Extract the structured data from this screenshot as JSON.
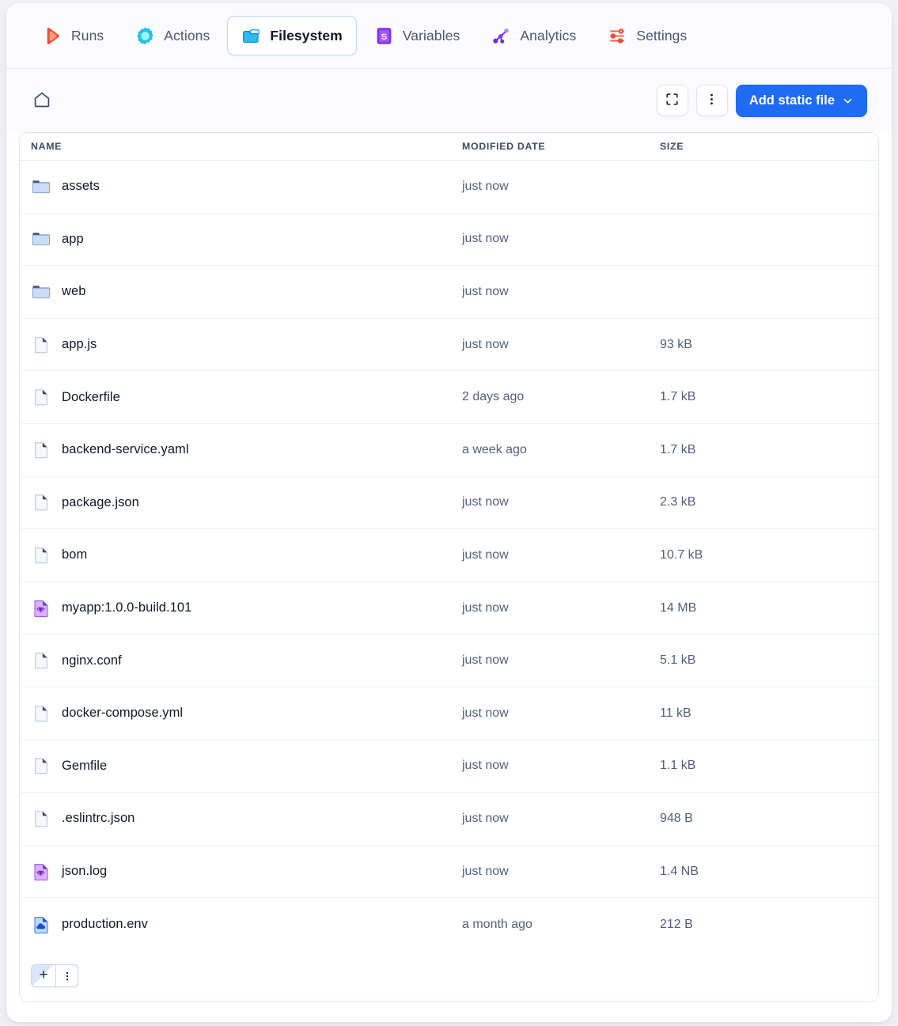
{
  "app": {
    "accent_color": "#1f6bf2",
    "card_background": "#ffffff",
    "page_background": "#f1f2f6"
  },
  "tabs": [
    {
      "label": "Runs",
      "icon": "play-triangle-icon",
      "active": false,
      "color": "#e8533a"
    },
    {
      "label": "Actions",
      "icon": "gear-flower-icon",
      "active": false,
      "color": "#22c3e6"
    },
    {
      "label": "Filesystem",
      "icon": "folder-icon",
      "active": true,
      "color": "#29b6f6"
    },
    {
      "label": "Variables",
      "icon": "variables-s-icon",
      "active": false,
      "color": "#7b2ff7"
    },
    {
      "label": "Analytics",
      "icon": "network-dots-icon",
      "active": false,
      "color": "#6d28d9"
    },
    {
      "label": "Settings",
      "icon": "sliders-icon",
      "active": false,
      "color": "#ef4836"
    }
  ],
  "toolbar": {
    "home_icon": "home-icon",
    "fullscreen_icon": "fullscreen-icon",
    "more_icon": "more-vertical-icon",
    "add_button_label": "Add static file",
    "add_button_chevron": "chevron-down-icon"
  },
  "table": {
    "columns": [
      "NAME",
      "MODIFIED DATE",
      "SIZE"
    ],
    "rows": [
      {
        "name": "assets",
        "modified": "just now",
        "size": "",
        "icon": "folder"
      },
      {
        "name": "app",
        "modified": "just now",
        "size": "",
        "icon": "folder"
      },
      {
        "name": "web",
        "modified": "just now",
        "size": "",
        "icon": "folder"
      },
      {
        "name": "app.js",
        "modified": "just now",
        "size": "93 kB",
        "icon": "file"
      },
      {
        "name": "Dockerfile",
        "modified": "2 days ago",
        "size": "1.7 kB",
        "icon": "file"
      },
      {
        "name": "backend-service.yaml",
        "modified": "a week ago",
        "size": "1.7 kB",
        "icon": "file"
      },
      {
        "name": "package.json",
        "modified": "just now",
        "size": "2.3 kB",
        "icon": "file"
      },
      {
        "name": "bom",
        "modified": "just now",
        "size": "10.7 kB",
        "icon": "file"
      },
      {
        "name": "myapp:1.0.0-build.101",
        "modified": "just now",
        "size": "14 MB",
        "icon": "gem"
      },
      {
        "name": "nginx.conf",
        "modified": "just now",
        "size": "5.1 kB",
        "icon": "file"
      },
      {
        "name": "docker-compose.yml",
        "modified": "just now",
        "size": "11 kB",
        "icon": "file"
      },
      {
        "name": "Gemfile",
        "modified": "just now",
        "size": "1.1 kB",
        "icon": "file"
      },
      {
        "name": ".eslintrc.json",
        "modified": "just now",
        "size": "948 B",
        "icon": "file"
      },
      {
        "name": "json.log",
        "modified": "just now",
        "size": "1.4 NB",
        "icon": "gem"
      },
      {
        "name": "production.env",
        "modified": "a month ago",
        "size": "212 B",
        "icon": "cloud"
      }
    ]
  },
  "footer": {
    "add_label": "+",
    "more_icon": "more-vertical-icon"
  }
}
